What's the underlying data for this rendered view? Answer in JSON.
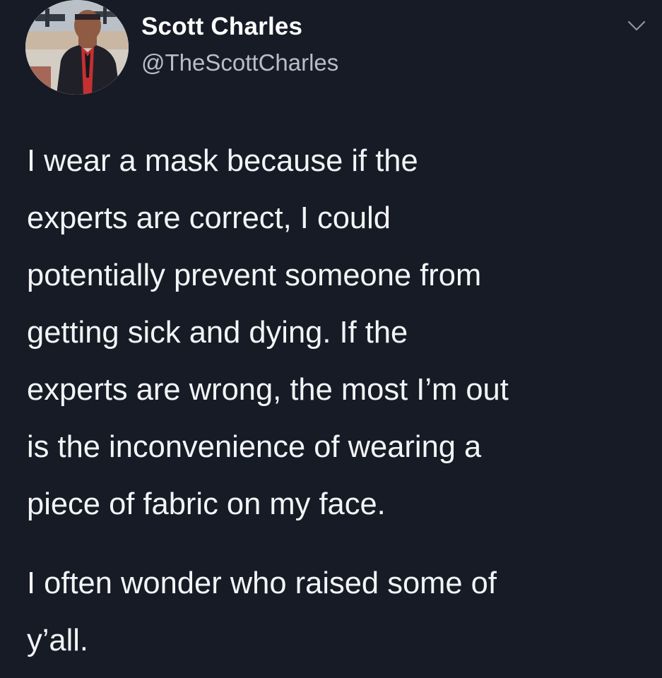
{
  "tweet": {
    "display_name": "Scott Charles",
    "handle": "@TheScottCharles",
    "avatar_icon": "profile-photo",
    "menu_icon": "chevron-down-icon",
    "paragraph_1_lines": [
      "I wear a mask because if the",
      "experts are correct, I could",
      "potentially prevent someone from",
      "getting sick and dying. If the",
      "experts are wrong, the most I’m out",
      "is the inconvenience of wearing a",
      "piece of fabric on my face."
    ],
    "paragraph_2_lines": [
      "I often wonder who raised some of",
      "y’all."
    ]
  },
  "theme": {
    "background": "#161b26",
    "primary_text": "#f3f4f6",
    "secondary_text": "#b9bdc6"
  }
}
